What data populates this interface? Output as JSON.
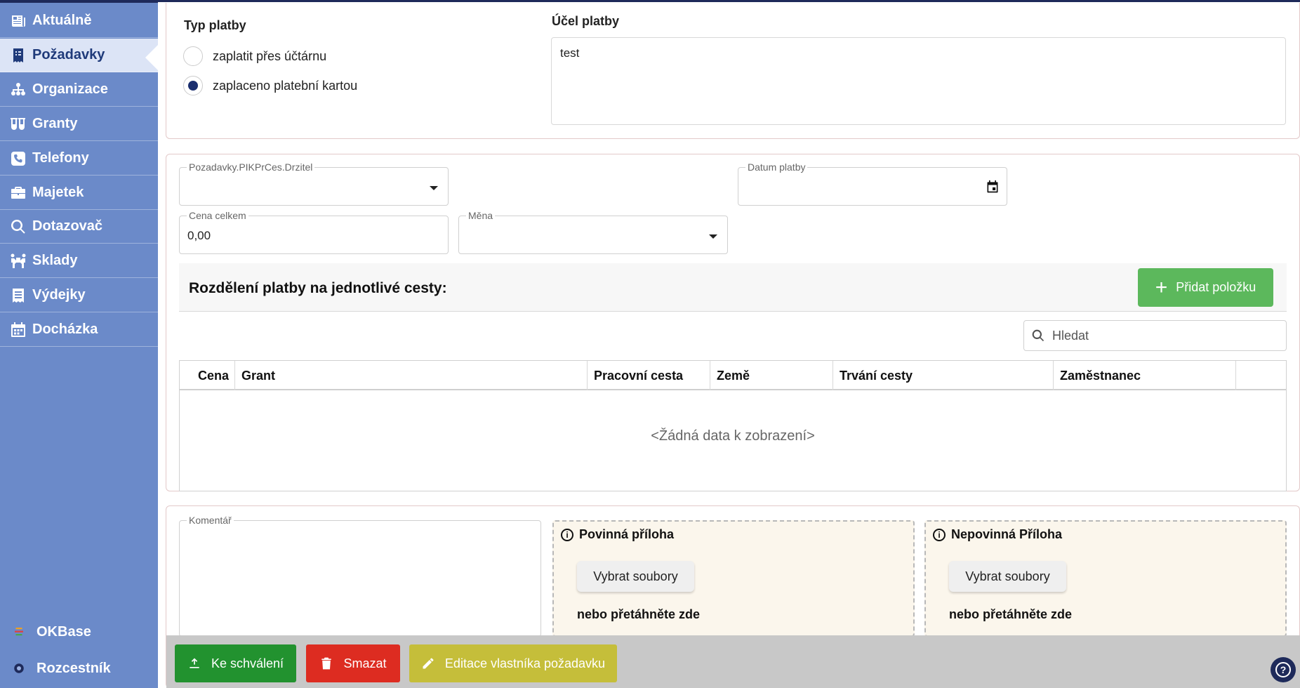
{
  "sidebar": {
    "items": [
      {
        "label": "Aktuálně",
        "icon": "newspaper-icon"
      },
      {
        "label": "Požadavky",
        "icon": "receipt-icon"
      },
      {
        "label": "Organizace",
        "icon": "org-chart-icon"
      },
      {
        "label": "Granty",
        "icon": "flask-icon"
      },
      {
        "label": "Telefony",
        "icon": "phone-icon"
      },
      {
        "label": "Majetek",
        "icon": "briefcase-icon"
      },
      {
        "label": "Dotazovač",
        "icon": "search-icon"
      },
      {
        "label": "Sklady",
        "icon": "people-carry-icon"
      },
      {
        "label": "Výdejky",
        "icon": "receipt-list-icon"
      },
      {
        "label": "Docházka",
        "icon": "calendar-icon"
      }
    ],
    "bottom": [
      {
        "label": "OKBase",
        "icon": "okbase-logo-icon"
      },
      {
        "label": "Rozcestník",
        "icon": "signpost-icon"
      }
    ]
  },
  "payment": {
    "type_label": "Typ platby",
    "options": [
      "zaplatit přes účtárnu",
      "zaplaceno platební kartou"
    ],
    "selected_index": 1,
    "purpose_label": "Účel platby",
    "purpose_value": "test"
  },
  "fields": {
    "holder_label": "Pozadavky.PIKPrCes.Drzitel",
    "holder_value": "",
    "date_label": "Datum platby",
    "date_value": "",
    "total_label": "Cena celkem",
    "total_value": "0,00",
    "currency_label": "Měna",
    "currency_value": ""
  },
  "split": {
    "title": "Rozdělení platby na jednotlivé cesty:",
    "add_button": "Přidat položku",
    "search_placeholder": "Hledat",
    "columns": [
      "Cena",
      "Grant",
      "Pracovní cesta",
      "Země",
      "Trvání cesty",
      "Zaměstnanec"
    ],
    "empty_text": "<Žádná data k zobrazení>"
  },
  "attachments": {
    "comment_label": "Komentář",
    "required_title": "Povinná příloha",
    "optional_title": "Nepovinná Příloha",
    "select_button": "Vybrat soubory",
    "drop_hint": "nebo přetáhněte zde"
  },
  "actions": {
    "approve": "Ke schválení",
    "delete": "Smazat",
    "edit_owner": "Editace vlastníka požadavku",
    "approve_color": "#22922f",
    "delete_color": "#dd2c21",
    "edit_color": "#c5be3a"
  },
  "help_label": "?"
}
